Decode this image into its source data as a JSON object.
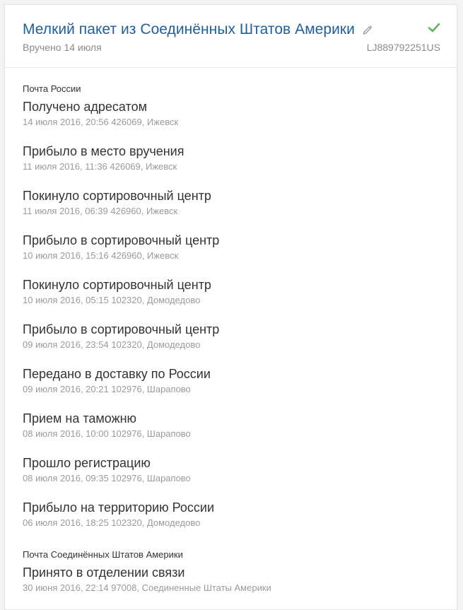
{
  "header": {
    "title": "Мелкий пакет из Соединённых Штатов Америки",
    "status": "Вручено 14 июля",
    "tracking_number": "LJ889792251US",
    "edit_icon": "pencil-icon",
    "status_icon": "check-icon",
    "accent_color": "#1f5f9c",
    "success_color": "#5cb85c"
  },
  "sections": [
    {
      "carrier": "Почта России",
      "events": [
        {
          "title": "Получено адресатом",
          "meta": "14 июля 2016, 20:56 426069, Ижевск"
        },
        {
          "title": "Прибыло в место вручения",
          "meta": "11 июля 2016, 11:36 426069, Ижевск"
        },
        {
          "title": "Покинуло сортировочный центр",
          "meta": "11 июля 2016, 06:39 426960, Ижевск"
        },
        {
          "title": "Прибыло в сортировочный центр",
          "meta": "10 июля 2016, 15:16 426960, Ижевск"
        },
        {
          "title": "Покинуло сортировочный центр",
          "meta": "10 июля 2016, 05:15 102320, Домодедово"
        },
        {
          "title": "Прибыло в сортировочный центр",
          "meta": "09 июля 2016, 23:54 102320, Домодедово"
        },
        {
          "title": "Передано в доставку по России",
          "meta": "09 июля 2016, 20:21 102976, Шарапово"
        },
        {
          "title": "Прием на таможню",
          "meta": "08 июля 2016, 10:00 102976, Шарапово"
        },
        {
          "title": "Прошло регистрацию",
          "meta": "08 июля 2016, 09:35 102976, Шарапово"
        },
        {
          "title": "Прибыло на территорию России",
          "meta": "06 июля 2016, 18:25 102320, Домодедово"
        }
      ]
    },
    {
      "carrier": "Почта Соединённых Штатов Америки",
      "events": [
        {
          "title": "Принято в отделении связи",
          "meta": "30 июня 2016, 22:14 97008, Соединенные Штаты Америки"
        }
      ]
    }
  ]
}
